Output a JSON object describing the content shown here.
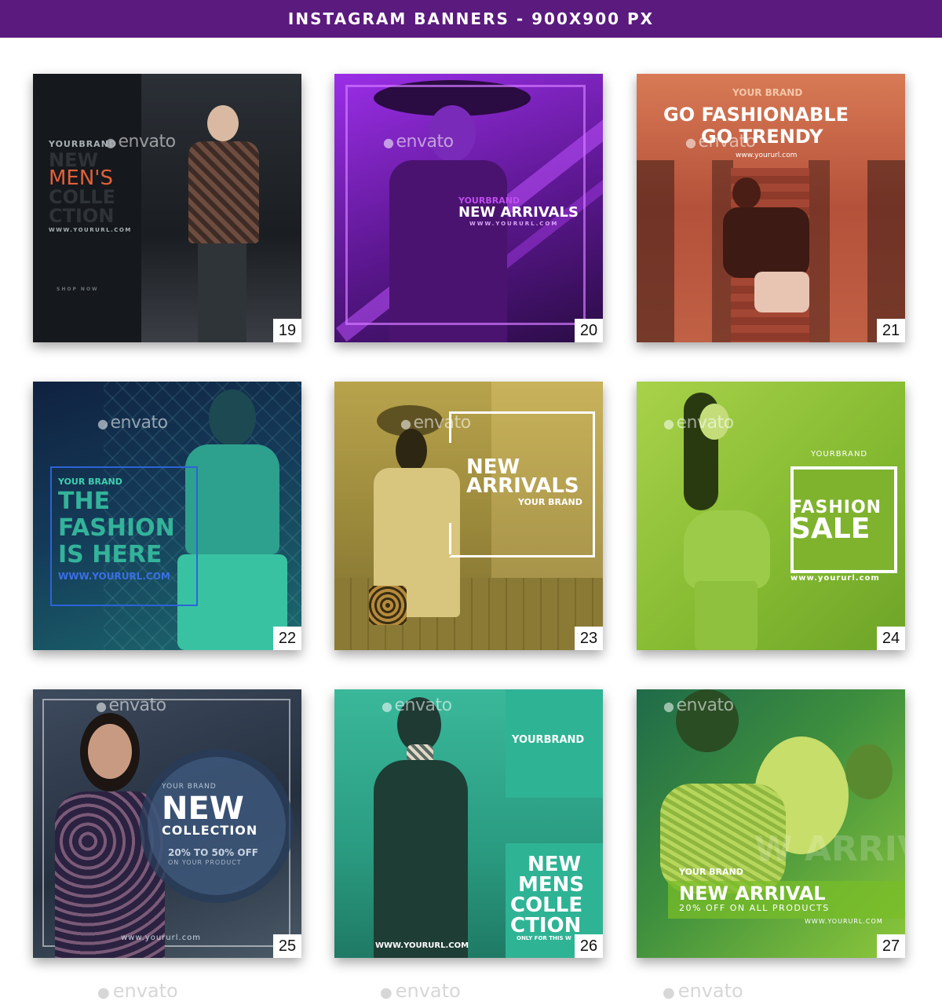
{
  "header": {
    "title": "INSTAGRAM BANNERS - 900X900 PX"
  },
  "watermark": "envato",
  "colors": {
    "header": "#5a1a7e"
  },
  "cards": [
    {
      "number": "19",
      "brand": "YOURBRAND",
      "line1": "NEW",
      "line2": "MEN'S",
      "line3": "COLLE",
      "line4": "CTION",
      "url": "WWW.YOURURL.COM",
      "cta": "SHOP NOW"
    },
    {
      "number": "20",
      "brand": "YOURBRAND",
      "headline": "NEW ARRIVALS",
      "url": "WWW.YOURURL.COM"
    },
    {
      "number": "21",
      "brand": "YOUR BRAND",
      "line1": "GO FASHIONABLE",
      "line2": "GO TRENDY",
      "url": "www.yoururl.com"
    },
    {
      "number": "22",
      "brand": "YOUR BRAND",
      "line1": "THE",
      "line2": "FASHION",
      "line3": "IS HERE",
      "url": "WWW.YOURURL.COM"
    },
    {
      "number": "23",
      "line1": "NEW",
      "line2": "ARRIVALS",
      "brand": "YOUR BRAND"
    },
    {
      "number": "24",
      "brand": "YOURBRAND",
      "line1": "FASHION",
      "line2": "SALE",
      "url": "www.yoururl.com"
    },
    {
      "number": "25",
      "brand": "YOUR BRAND",
      "line1": "NEW",
      "line2": "COLLECTION",
      "offer": "20% TO 50% OFF",
      "offer_sub": "ON YOUR PRODUCT",
      "url": "www.yoururl.com"
    },
    {
      "number": "26",
      "brand": "YOURBRAND",
      "line1": "NEW",
      "line2": "MENS",
      "line3": "COLLE",
      "line4": "CTION",
      "tag": "ONLY FOR THIS W",
      "url": "WWW.YOURURL.COM"
    },
    {
      "number": "27",
      "brand": "YOUR BRAND",
      "headline": "NEW ARRIVAL",
      "offer": "20% OFF ON ALL PRODUCTS",
      "url": "WWW.YOURURL.COM",
      "bg_text": "W ARRIV"
    }
  ]
}
